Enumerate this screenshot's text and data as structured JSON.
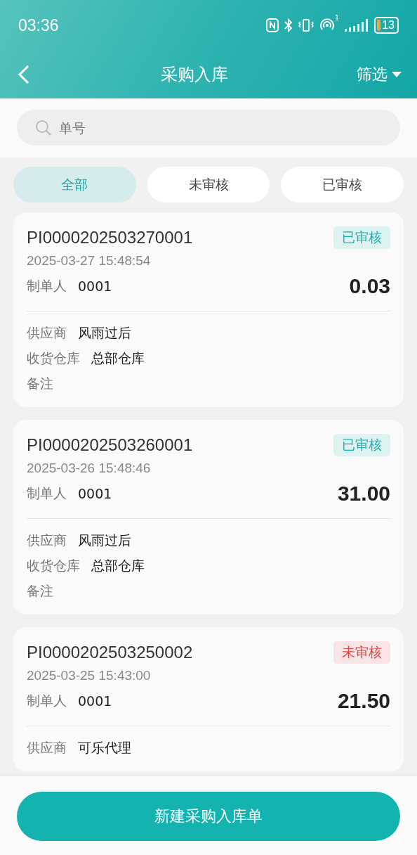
{
  "status_bar": {
    "time": "03:36",
    "hotspot_count": "1",
    "battery": "13"
  },
  "header": {
    "title": "采购入库",
    "filter": "筛选"
  },
  "search": {
    "placeholder": "单号"
  },
  "tabs": [
    {
      "label": "全部",
      "selected": true
    },
    {
      "label": "未审核",
      "selected": false
    },
    {
      "label": "已审核",
      "selected": false
    }
  ],
  "orders": [
    {
      "number": "PI0000202503270001",
      "time": "2025-03-27 15:48:54",
      "status": "已审核",
      "kind": "approved",
      "creator_label": "制单人",
      "creator": "0001",
      "amount": "0.03",
      "fields": [
        {
          "label": "供应商",
          "value": "风雨过后"
        },
        {
          "label": "收货仓库",
          "value": "总部仓库"
        },
        {
          "label": "备注"
        }
      ]
    },
    {
      "number": "PI0000202503260001",
      "time": "2025-03-26 15:48:46",
      "status": "已审核",
      "kind": "approved",
      "creator_label": "制单人",
      "creator": "0001",
      "amount": "31.00",
      "fields": [
        {
          "label": "供应商",
          "value": "风雨过后"
        },
        {
          "label": "收货仓库",
          "value": "总部仓库"
        },
        {
          "label": "备注"
        }
      ]
    },
    {
      "number": "PI0000202503250002",
      "time": "2025-03-25 15:43:00",
      "status": "未审核",
      "kind": "pending",
      "creator_label": "制单人",
      "creator": "0001",
      "amount": "21.50",
      "fields": [
        {
          "label": "供应商",
          "value": "可乐代理"
        }
      ]
    }
  ],
  "new_button": "新建采购入库单"
}
